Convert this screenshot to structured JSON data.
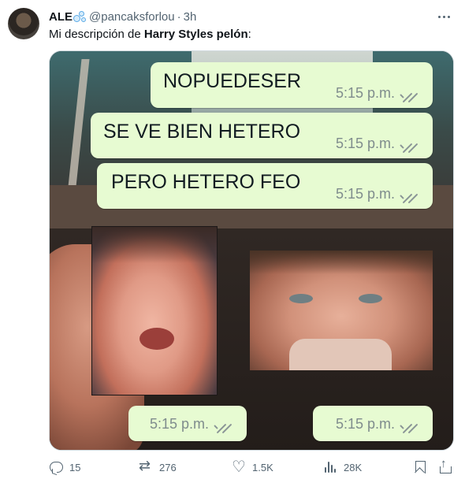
{
  "tweet": {
    "author_name": "ALE",
    "author_emoji": "bubbles-emoji",
    "handle": "@pancaksforlou",
    "separator": "·",
    "time": "3h",
    "text_prefix": "Mi descripción de ",
    "text_bold": "Harry Styles pelón",
    "text_suffix": ":"
  },
  "media": {
    "bubbles": [
      {
        "text": "NOPUEDESER",
        "time": "5:15 p.m."
      },
      {
        "text": "SE VE BIEN HETERO",
        "time": "5:15 p.m."
      },
      {
        "text": "PERO HETERO FEO",
        "time": "5:15 p.m."
      },
      {
        "text": "",
        "time": "5:15 p.m."
      },
      {
        "text": "",
        "time": "5:15 p.m."
      }
    ],
    "tick_icon": "double-check-icon",
    "bubble_color": "#e7fbd2"
  },
  "actions": {
    "replies": "15",
    "retweets": "276",
    "likes": "1.5K",
    "views": "28K"
  },
  "colors": {
    "text_primary": "#0f1419",
    "text_secondary": "#536471"
  }
}
